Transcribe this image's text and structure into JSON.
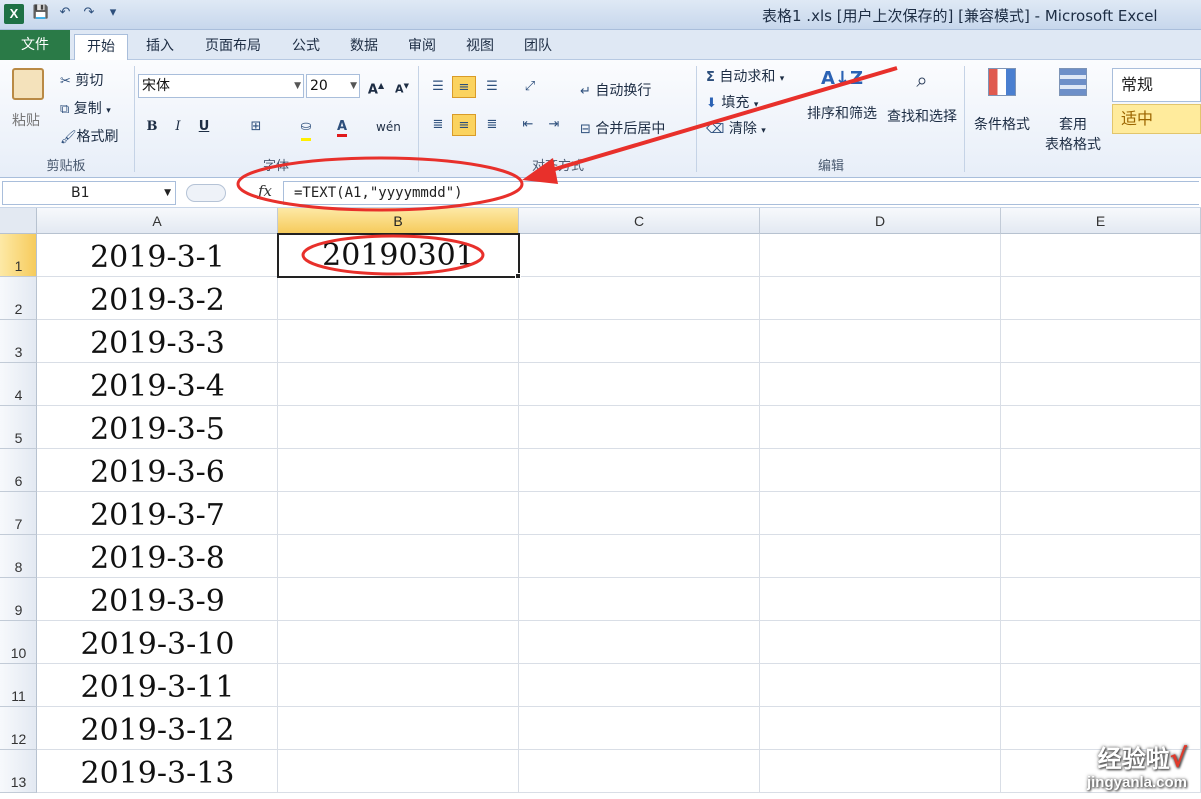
{
  "window": {
    "title": "表格1 .xls [用户上次保存的]  [兼容模式] - Microsoft Excel",
    "app_icon": "X"
  },
  "quick_access": {
    "save_icon": "💾",
    "undo_icon": "↶",
    "redo_icon": "↷",
    "customize_icon": "▾"
  },
  "tabs": [
    "文件",
    "开始",
    "插入",
    "页面布局",
    "公式",
    "数据",
    "审阅",
    "视图",
    "团队"
  ],
  "ribbon": {
    "clipboard": {
      "paste": "粘贴",
      "cut": "剪切",
      "copy": "复制",
      "format_painter": "格式刷",
      "label": "剪贴板"
    },
    "font": {
      "name": "宋体",
      "size": "20",
      "bold": "B",
      "italic": "I",
      "underline": "U",
      "phonetic": "wén",
      "label": "字体",
      "grow": "A",
      "shrink": "A"
    },
    "alignment": {
      "wrap_text": "自动换行",
      "merge_center": "合并后居中",
      "label": "对齐方式"
    },
    "editing": {
      "autosum": "自动求和",
      "fill": "填充",
      "clear": "清除",
      "sort_filter": "排序和筛选",
      "find_select": "查找和选择",
      "label": "编辑"
    },
    "styles": {
      "conditional": "条件格式",
      "table_format_1": "套用",
      "table_format_2": "表格格式",
      "normal": "常规",
      "neutral": "适中"
    }
  },
  "formula_bar": {
    "name_box": "B1",
    "fx": "fx",
    "formula": "=TEXT(A1,\"yyyymmdd\")"
  },
  "columns": [
    "A",
    "B",
    "C",
    "D",
    "E"
  ],
  "rows": [
    "1",
    "2",
    "3",
    "4",
    "5",
    "6",
    "7",
    "8",
    "9",
    "10",
    "11",
    "12",
    "13"
  ],
  "cells": {
    "A": [
      "2019-3-1",
      "2019-3-2",
      "2019-3-3",
      "2019-3-4",
      "2019-3-5",
      "2019-3-6",
      "2019-3-7",
      "2019-3-8",
      "2019-3-9",
      "2019-3-10",
      "2019-3-11",
      "2019-3-12",
      "2019-3-13"
    ],
    "B1": "20190301"
  },
  "selected_cell": "B1",
  "annotation_color": "#e8302b",
  "watermark": {
    "line1": "经验啦",
    "check": "√",
    "line2": "jingyanla.com"
  }
}
